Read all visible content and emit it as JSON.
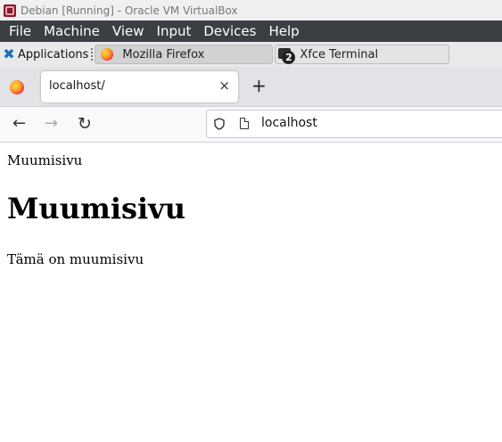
{
  "vbox": {
    "title": "Debian [Running] - Oracle VM VirtualBox",
    "menu": [
      "File",
      "Machine",
      "View",
      "Input",
      "Devices",
      "Help"
    ]
  },
  "panel": {
    "applications_label": "Applications",
    "tasks": [
      {
        "label": "Mozilla Firefox",
        "icon": "firefox-icon"
      },
      {
        "label": "Xfce Terminal",
        "icon": "terminal-icon",
        "badge": "2"
      }
    ]
  },
  "browser": {
    "tab_title": "localhost/",
    "tab_close": "×",
    "new_tab": "+",
    "nav": {
      "back": "←",
      "forward": "→",
      "reload": "↻"
    },
    "url": "localhost"
  },
  "page": {
    "top_text": "Muumisivu",
    "heading": "Muumisivu",
    "paragraph": "Tämä on muumisivu"
  }
}
